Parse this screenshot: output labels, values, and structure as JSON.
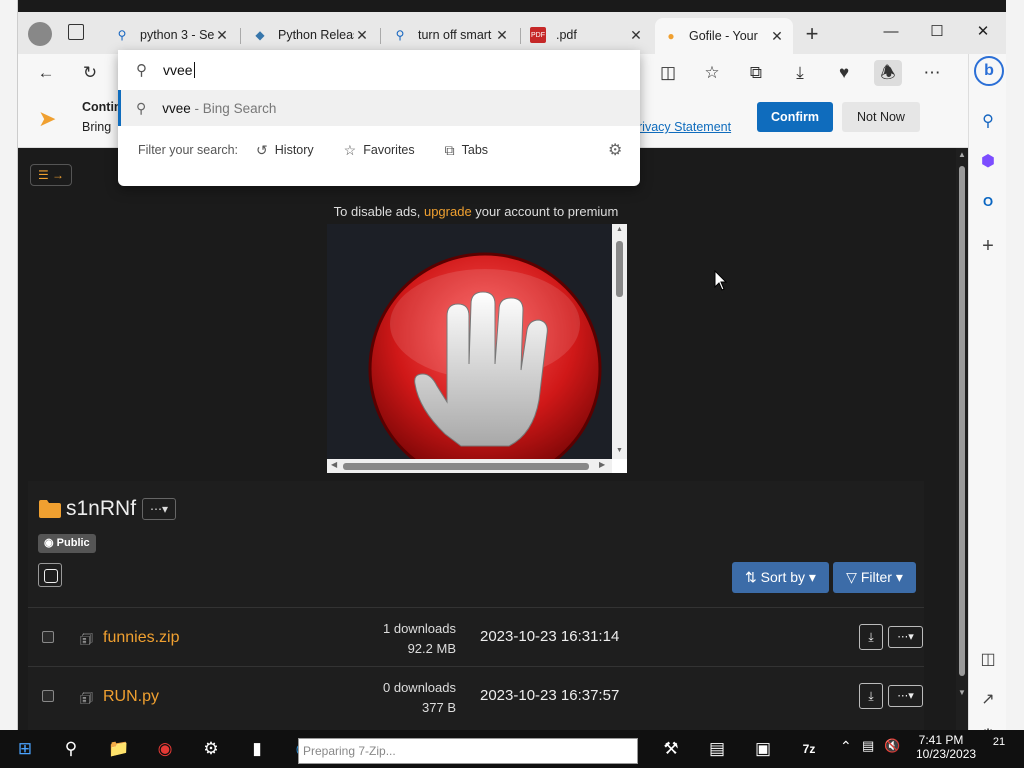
{
  "browser": {
    "tabs": [
      {
        "title": "python 3 - Se",
        "icon": "search-icon"
      },
      {
        "title": "Python Releas",
        "icon": "python-icon"
      },
      {
        "title": "turn off smart",
        "icon": "search-icon"
      },
      {
        "title": ".pdf",
        "icon": "pdf-icon"
      },
      {
        "title": "Gofile - Your",
        "icon": "gofile-icon"
      }
    ],
    "new_tab": "+"
  },
  "omnibox": {
    "query": "vvee",
    "suggestion_term": "vvee",
    "suggestion_source": " - Bing Search",
    "filter_label": "Filter your search:",
    "filters": [
      "History",
      "Favorites",
      "Tabs"
    ]
  },
  "notification": {
    "title": "Contin",
    "body": "Bring",
    "link": "rivacy Statement",
    "confirm_label": "Confirm",
    "not_now_label": "Not Now"
  },
  "page": {
    "ad_text_prefix": "To disable ads, ",
    "ad_link": "upgrade",
    "ad_text_suffix": " your account to premium",
    "folder_name": "s1nRNf",
    "visibility": "Public",
    "sort_label": "Sort by",
    "filter_label": "Filter",
    "files": [
      {
        "name": "funnies.zip",
        "downloads": "1 downloads",
        "size": "92.2 MB",
        "date": "2023-10-23 16:31:14"
      },
      {
        "name": "RUN.py",
        "downloads": "0 downloads",
        "size": "377 B",
        "date": "2023-10-23 16:37:57"
      }
    ]
  },
  "taskbar": {
    "running_task": "Preparing 7-Zip...",
    "time": "7:41 PM",
    "date": "10/23/2023",
    "notification_count": "21"
  },
  "colors": {
    "accent": "#0f6cbd",
    "gofile_orange": "#f0a030",
    "gofile_blue": "#3c6ca8",
    "page_bg": "#1b1b1b"
  }
}
